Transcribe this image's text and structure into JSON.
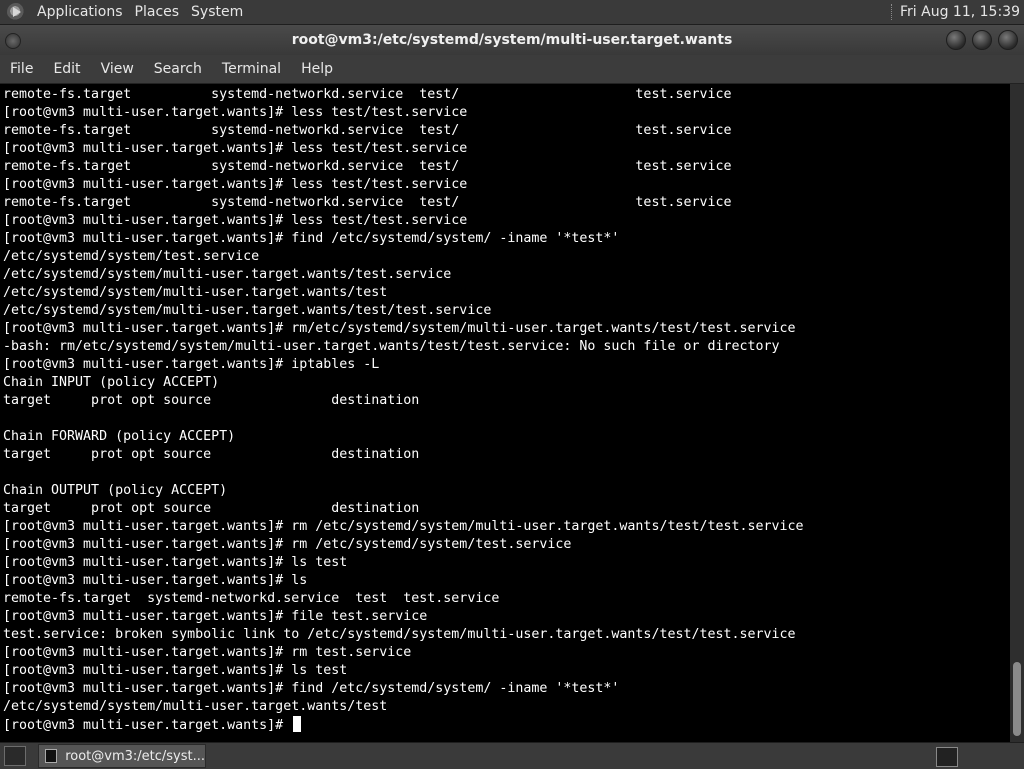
{
  "top_panel": {
    "menus": [
      "Applications",
      "Places",
      "System"
    ],
    "clock": "Fri Aug 11, 15:39"
  },
  "window": {
    "title": "root@vm3:/etc/systemd/system/multi-user.target.wants"
  },
  "menubar": {
    "items": [
      "File",
      "Edit",
      "View",
      "Search",
      "Terminal",
      "Help"
    ]
  },
  "terminal": {
    "lines": [
      "remote-fs.target          systemd-networkd.service  test/                      test.service",
      "[root@vm3 multi-user.target.wants]# less test/test.service",
      "remote-fs.target          systemd-networkd.service  test/                      test.service",
      "[root@vm3 multi-user.target.wants]# less test/test.service",
      "remote-fs.target          systemd-networkd.service  test/                      test.service",
      "[root@vm3 multi-user.target.wants]# less test/test.service",
      "remote-fs.target          systemd-networkd.service  test/                      test.service",
      "[root@vm3 multi-user.target.wants]# less test/test.service",
      "[root@vm3 multi-user.target.wants]# find /etc/systemd/system/ -iname '*test*'",
      "/etc/systemd/system/test.service",
      "/etc/systemd/system/multi-user.target.wants/test.service",
      "/etc/systemd/system/multi-user.target.wants/test",
      "/etc/systemd/system/multi-user.target.wants/test/test.service",
      "[root@vm3 multi-user.target.wants]# rm/etc/systemd/system/multi-user.target.wants/test/test.service",
      "-bash: rm/etc/systemd/system/multi-user.target.wants/test/test.service: No such file or directory",
      "[root@vm3 multi-user.target.wants]# iptables -L",
      "Chain INPUT (policy ACCEPT)",
      "target     prot opt source               destination",
      "",
      "Chain FORWARD (policy ACCEPT)",
      "target     prot opt source               destination",
      "",
      "Chain OUTPUT (policy ACCEPT)",
      "target     prot opt source               destination",
      "[root@vm3 multi-user.target.wants]# rm /etc/systemd/system/multi-user.target.wants/test/test.service",
      "[root@vm3 multi-user.target.wants]# rm /etc/systemd/system/test.service",
      "[root@vm3 multi-user.target.wants]# ls test",
      "[root@vm3 multi-user.target.wants]# ls",
      "remote-fs.target  systemd-networkd.service  test  test.service",
      "[root@vm3 multi-user.target.wants]# file test.service",
      "test.service: broken symbolic link to /etc/systemd/system/multi-user.target.wants/test/test.service",
      "[root@vm3 multi-user.target.wants]# rm test.service",
      "[root@vm3 multi-user.target.wants]# ls test",
      "[root@vm3 multi-user.target.wants]# find /etc/systemd/system/ -iname '*test*'",
      "/etc/systemd/system/multi-user.target.wants/test"
    ],
    "prompt": "[root@vm3 multi-user.target.wants]# "
  },
  "taskbar": {
    "task_label": "root@vm3:/etc/syst..."
  }
}
